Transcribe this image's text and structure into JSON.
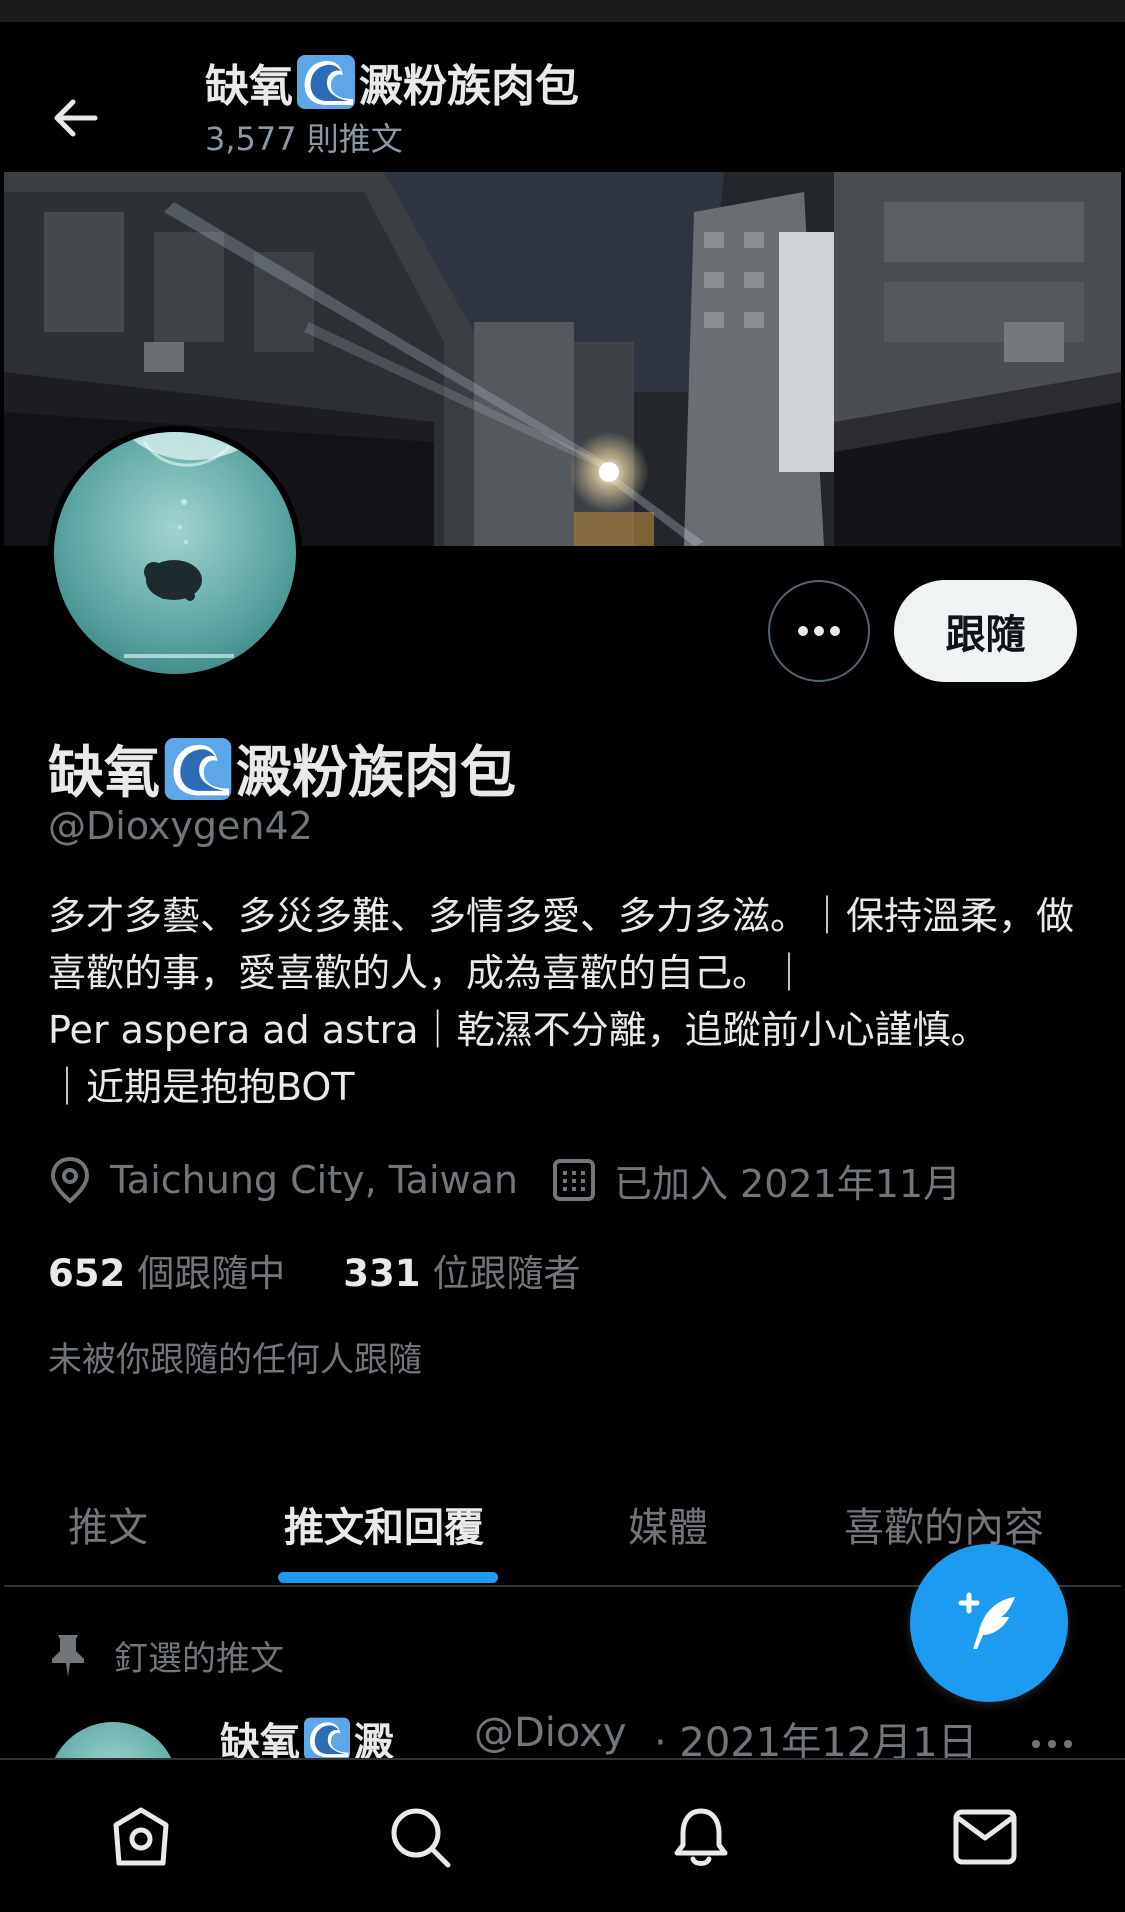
{
  "header": {
    "name_part1": "缺氧",
    "name_part2": "澱粉族肉包",
    "tweet_count": "3,577 則推文"
  },
  "profile": {
    "name_part1": "缺氧",
    "name_part2": "澱粉族肉包",
    "handle": "@Dioxygen42",
    "bio": "多才多藝、多災多難、多情多愛、多力多滋。｜保持溫柔，做喜歡的事，愛喜歡的人，成為喜歡的自己。｜\nPer aspera ad astra｜乾濕不分離，追蹤前小心謹慎。\n｜近期是抱抱BOT",
    "location": "Taichung City, Taiwan",
    "joined": "已加入 2021年11月",
    "following_count": "652",
    "following_label": "個跟隨中",
    "followers_count": "331",
    "followers_label": "位跟隨者",
    "not_followed_text": "未被你跟隨的任何人跟隨",
    "follow_button": "跟隨"
  },
  "tabs": [
    {
      "label": "推文",
      "active": false
    },
    {
      "label": "推文和回覆",
      "active": true
    },
    {
      "label": "媒體",
      "active": false
    },
    {
      "label": "喜歡的內容",
      "active": false
    }
  ],
  "pinned": {
    "label": "釘選的推文"
  },
  "tweet": {
    "name_part1": "缺氧",
    "name_part2": "澱",
    "handle": "@Dioxy",
    "date": "· 2021年12月1日"
  },
  "icons": {
    "back": "arrow-left-icon",
    "more": "ellipsis-icon",
    "location": "location-pin-icon",
    "calendar": "calendar-icon",
    "pin": "pin-icon",
    "compose": "compose-tweet-icon",
    "home": "home-icon",
    "search": "search-icon",
    "notifications": "bell-icon",
    "messages": "mail-icon",
    "wave_emoji": "wave-emoji-icon"
  },
  "colors": {
    "accent": "#1d9bf0",
    "background": "#000000",
    "text_primary": "#e7e9ea",
    "text_secondary": "#71767b"
  }
}
